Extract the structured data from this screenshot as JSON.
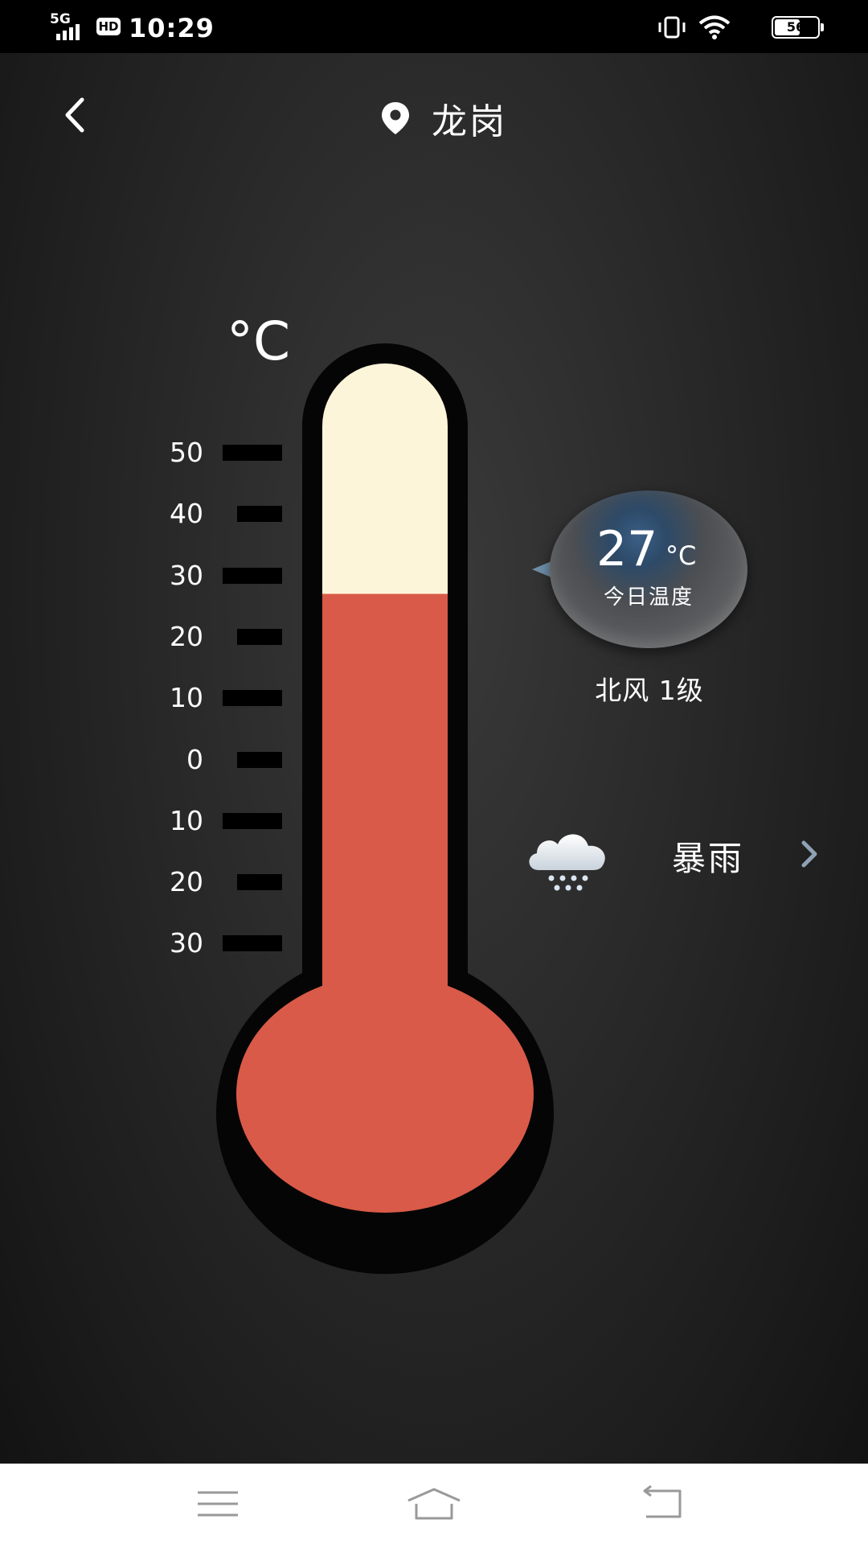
{
  "status_bar": {
    "network": "5G",
    "hd": "HD",
    "time": "10:29",
    "battery": "56"
  },
  "header": {
    "back_icon": "chevron-left-icon",
    "location_icon": "map-pin-icon",
    "city": "龙岗"
  },
  "thermometer": {
    "unit": "°C",
    "scale_labels": [
      "50",
      "40",
      "30",
      "20",
      "10",
      "0",
      "10",
      "20",
      "30"
    ],
    "current_temp": 27,
    "fill_color": "#d95a48",
    "empty_color": "#fdf5d9"
  },
  "today": {
    "temp": "27",
    "unit": "°C",
    "caption": "今日温度",
    "wind": "北风 1级"
  },
  "weather": {
    "icon": "rain-cloud-icon",
    "condition": "暴雨",
    "chevron_icon": "chevron-right-icon"
  },
  "nav_bar": {
    "menu_icon": "menu-icon",
    "home_icon": "home-icon",
    "back_icon": "back-icon"
  }
}
